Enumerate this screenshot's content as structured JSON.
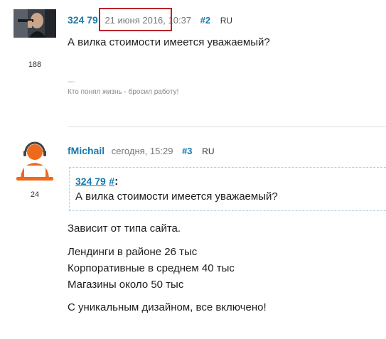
{
  "posts": [
    {
      "author": "324 79",
      "date": "21 июня 2016, 10:37",
      "permalink": "#2",
      "lang": "RU",
      "post_count": "188",
      "text": "А вилка стоимости имеется уважаемый?",
      "sig_separator": "---",
      "signature": "Кто понял жизнь - бросил работу!"
    },
    {
      "author": "fMichail",
      "date": "сегодня, 15:29",
      "permalink": "#3",
      "lang": "RU",
      "post_count": "24",
      "quote": {
        "author": "324 79",
        "hash": "#",
        "separator": ":",
        "text": "А вилка стоимости имеется уважаемый?"
      },
      "lines": [
        "Зависит от типа сайта.",
        "Лендинги в районе 26 тыс",
        "Корпоративные в среднем 40 тыс",
        "Магазины около 50 тыс",
        "С уникальным дизайном, все включено!"
      ]
    }
  ],
  "colors": {
    "link": "#1a7ab0",
    "highlight": "#b8232b",
    "avatar_orange": "#ee6a1b"
  },
  "icons": {
    "post2_avatar": "photo-avatar",
    "post3_avatar": "user-with-laptop-icon"
  }
}
